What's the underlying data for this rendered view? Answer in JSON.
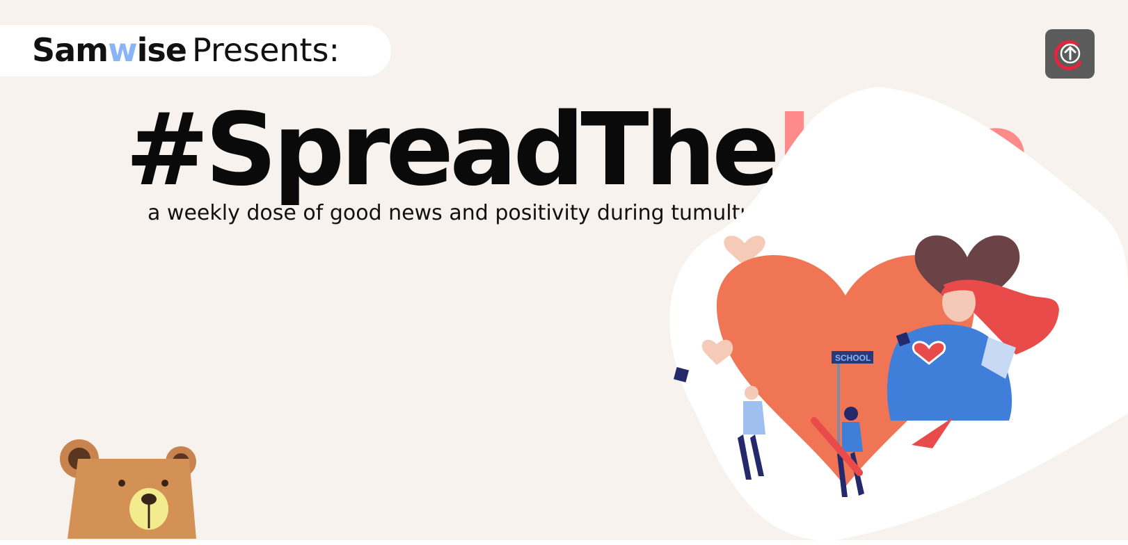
{
  "brand": {
    "part1": "Sam",
    "part2": "w",
    "part3": "ise",
    "presents": "Presents:"
  },
  "headline": {
    "main": "#SpreadThe",
    "accent": "Love"
  },
  "tagline": "a weekly dose of good news and positivity during tumultuous times",
  "sign_text": "SCHOOL",
  "icons": {
    "upload": "upload-arrow-icon",
    "bear": "bear-mascot-icon",
    "illustration": "heart-people-illustration"
  },
  "colors": {
    "background": "#f7f2ed",
    "accent_pink": "#ff8a8a",
    "brand_blue": "#8ab4f8",
    "heart": "#ef7555"
  }
}
